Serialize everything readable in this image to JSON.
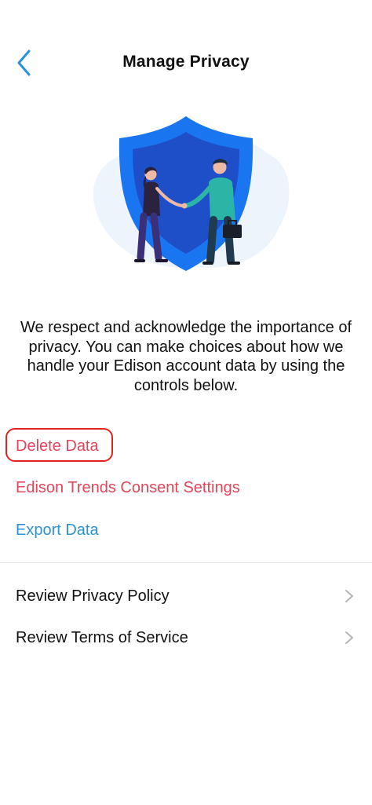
{
  "header": {
    "title": "Manage Privacy",
    "back_icon": "chevron-left-icon"
  },
  "hero": {
    "illustration": "privacy-shield-handshake-illustration",
    "colors": {
      "shield_outer": "#1a75f0",
      "shield_inner": "#1e4fc8",
      "blob": "#eef4fb"
    }
  },
  "intro": {
    "text": "We respect and acknowledge the importance of privacy. You can make choices about how we handle your Edison account data by using the controls below."
  },
  "actions": {
    "delete_label": "Delete Data",
    "trends_label": "Edison Trends Consent Settings",
    "export_label": "Export Data"
  },
  "links": [
    {
      "label": "Review Privacy Policy",
      "icon": "chevron-right-icon"
    },
    {
      "label": "Review Terms of Service",
      "icon": "chevron-right-icon"
    }
  ],
  "colors": {
    "accent_blue": "#2a93d8",
    "destructive_red": "#e4455a",
    "highlight_ring": "#e0231f",
    "chevron_gray": "#b4b4b9"
  }
}
